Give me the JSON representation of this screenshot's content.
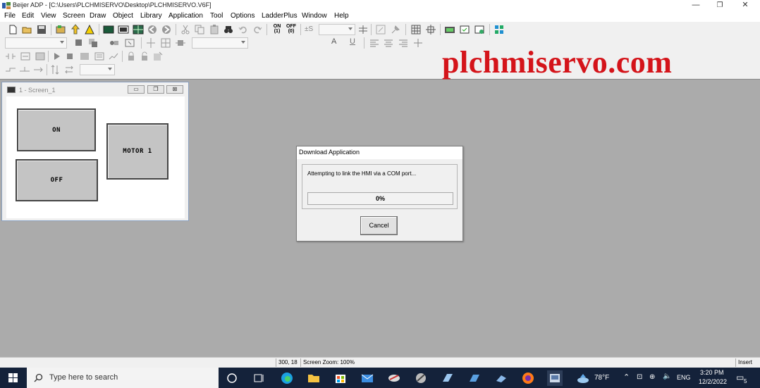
{
  "window": {
    "title": "Beijer ADP - [C:\\Users\\PLCHMISERVO\\Desktop\\PLCHMISERVO.V6F]",
    "minimize_glyph": "—",
    "restore_glyph": "❐",
    "close_glyph": "✕"
  },
  "menu": [
    "File",
    "Edit",
    "View",
    "Screen",
    "Draw",
    "Object",
    "Library",
    "Application",
    "Tool",
    "Options",
    "LadderPlus",
    "Window",
    "Help"
  ],
  "toolbar": {
    "on_label": "ON",
    "on_sub": "(1)",
    "off_label": "OFF",
    "off_sub": "(0)",
    "sign_label": "±S",
    "text_size_label": "A",
    "underline_label": "U"
  },
  "watermark": "plchmiservo.com",
  "child_window": {
    "title": "1 - Screen_1",
    "buttons": {
      "on": "ON",
      "off": "OFF",
      "motor": "MOTOR 1"
    }
  },
  "dialog": {
    "title": "Download Application",
    "message": "Attempting to link the HMI via a COM port...",
    "progress_text": "0%",
    "progress_value": 0,
    "cancel": "Cancel"
  },
  "statusbar": {
    "coords": "300, 18",
    "zoom": "Screen Zoom: 100%",
    "mode": "Insert"
  },
  "taskbar": {
    "search_placeholder": "Type here to search",
    "weather": "78°F",
    "language": "ENG",
    "time": "3:20 PM",
    "date": "12/2/2022",
    "notification_count": "5"
  },
  "colors": {
    "workspace": "#ababab",
    "watermark": "#d4141a",
    "taskbar": "#14223a",
    "progress": "#2a7ad5"
  }
}
